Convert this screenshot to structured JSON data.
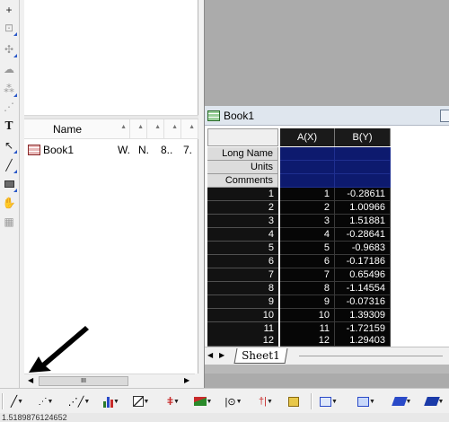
{
  "left_tools": [
    "plus-crosshair-icon",
    "zoom-box-icon",
    "data-reader-icon",
    "screen-reader-icon",
    "mask-icon",
    "region-icon",
    "text-tool-icon",
    "arrow-tool-icon",
    "line-tool-icon",
    "rectangle-tool-icon",
    "hand-tool-icon",
    "draw-data-icon"
  ],
  "explorer": {
    "columns": [
      "Name",
      "",
      "",
      "",
      ""
    ],
    "items": [
      {
        "name": "Book1",
        "c1": "W.",
        "c2": "N.",
        "c3": "8..",
        "c4": "7."
      }
    ],
    "scroll_thumb": "III"
  },
  "workbook": {
    "title": "Book1",
    "columns": [
      "A(X)",
      "B(Y)"
    ],
    "label_rows": [
      "Long Name",
      "Units",
      "Comments"
    ],
    "rows": [
      {
        "n": "1",
        "a": "1",
        "b": "-0.28611"
      },
      {
        "n": "2",
        "a": "2",
        "b": "1.00966"
      },
      {
        "n": "3",
        "a": "3",
        "b": "1.51881"
      },
      {
        "n": "4",
        "a": "4",
        "b": "-0.28641"
      },
      {
        "n": "5",
        "a": "5",
        "b": "-0.9683"
      },
      {
        "n": "6",
        "a": "6",
        "b": "-0.17186"
      },
      {
        "n": "7",
        "a": "7",
        "b": "0.65496"
      },
      {
        "n": "8",
        "a": "8",
        "b": "-1.14554"
      },
      {
        "n": "9",
        "a": "9",
        "b": "-0.07316"
      },
      {
        "n": "10",
        "a": "10",
        "b": "1.39309"
      },
      {
        "n": "11",
        "a": "11",
        "b": "-1.72159"
      },
      {
        "n": "12",
        "a": "12",
        "b": "1.29403"
      }
    ],
    "sheet_tab": "Sheet1"
  },
  "toolbar_icons": [
    "line-plot-icon",
    "scatter-plot-icon",
    "line-symbol-plot-icon",
    "column-plot-icon",
    "box-chart-icon",
    "error-bar-icon",
    "area-plot-icon",
    "contour-icon",
    "stat-plot-icon",
    "template-icon",
    "layout-icon",
    "copy-page-icon",
    "plot-3d-icon",
    "waterfall-icon"
  ],
  "status_text": "1.5189876124652"
}
